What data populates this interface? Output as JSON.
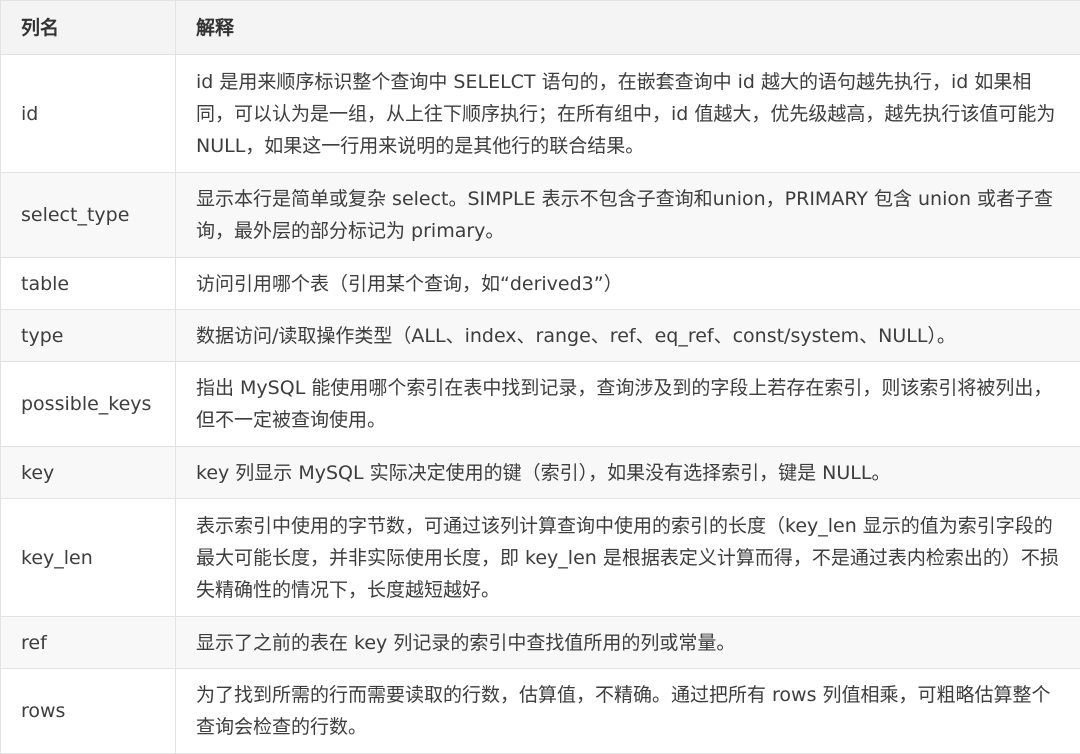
{
  "table": {
    "headers": [
      "列名",
      "解释"
    ],
    "rows": [
      {
        "name": "id",
        "desc": "id 是用来顺序标识整个查询中 SELELCT 语句的，在嵌套查询中 id 越大的语句越先执行，id 如果相同，可以认为是一组，从上往下顺序执行；在所有组中，id 值越大，优先级越高，越先执行该值可能为 NULL，如果这一行用来说明的是其他行的联合结果。"
      },
      {
        "name": "select_type",
        "desc": "显示本行是简单或复杂 select。SIMPLE 表示不包含子查询和union，PRIMARY 包含 union 或者子查询，最外层的部分标记为 primary。"
      },
      {
        "name": "table",
        "desc": "访问引用哪个表（引用某个查询，如“derived3”）"
      },
      {
        "name": "type",
        "desc": "数据访问/读取操作类型（ALL、index、range、ref、eq_ref、const/system、NULL）。"
      },
      {
        "name": "possible_keys",
        "desc": "指出 MySQL 能使用哪个索引在表中找到记录，查询涉及到的字段上若存在索引，则该索引将被列出，但不一定被查询使用。"
      },
      {
        "name": "key",
        "desc": "key 列显示 MySQL 实际决定使用的键（索引），如果没有选择索引，键是 NULL。"
      },
      {
        "name": "key_len",
        "desc": "表示索引中使用的字节数，可通过该列计算查询中使用的索引的长度（key_len 显示的值为索引字段的最大可能长度，并非实际使用长度，即 key_len 是根据表定义计算而得，不是通过表内检索出的）不损失精确性的情况下，长度越短越好。"
      },
      {
        "name": "ref",
        "desc": "显示了之前的表在 key 列记录的索引中查找值所用的列或常量。"
      },
      {
        "name": "rows",
        "desc": "为了找到所需的行而需要读取的行数，估算值，不精确。通过把所有 rows 列值相乘，可粗略估算整个查询会检查的行数。"
      }
    ]
  }
}
